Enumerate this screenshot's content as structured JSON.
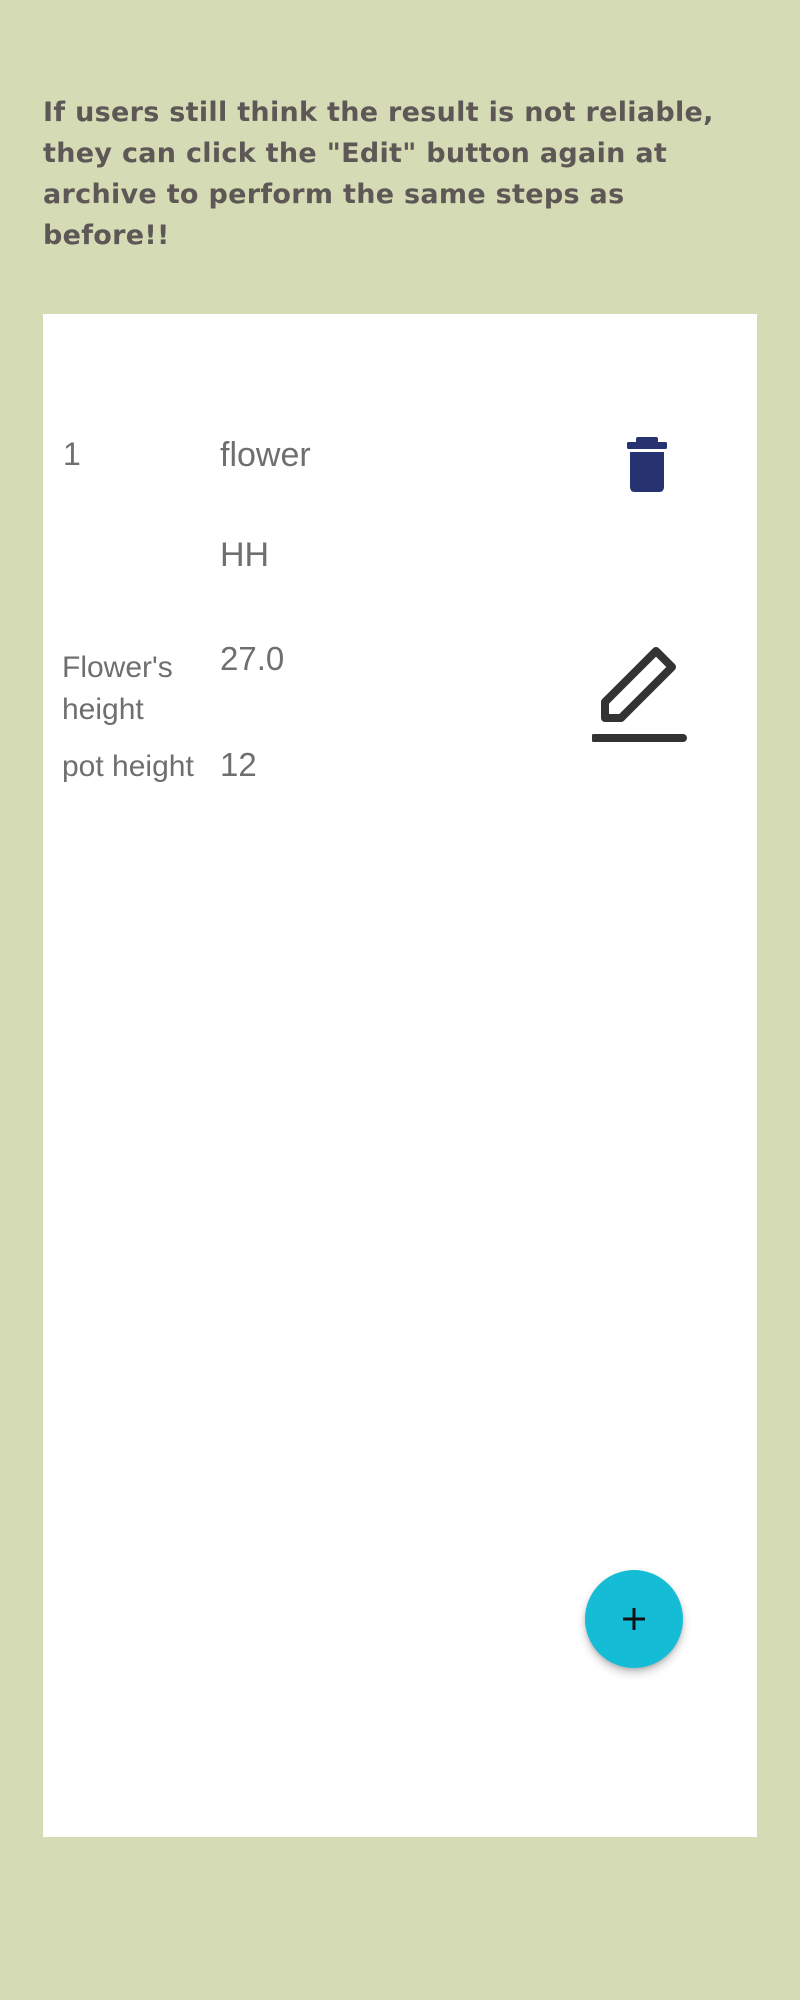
{
  "instruction": {
    "text": "If users still think the result is not reliable, they can click the \"Edit\" button again at archive  to perform the same steps as before!!"
  },
  "record": {
    "index": "1",
    "name": "flower",
    "code": "HH",
    "fields": [
      {
        "label": "Flower's height",
        "value": "27.0"
      },
      {
        "label": "pot height",
        "value": "12"
      }
    ]
  },
  "actions": {
    "delete_icon": "trash-icon",
    "edit_icon": "pencil-icon",
    "add_icon": "plus-icon"
  },
  "colors": {
    "background": "#d5dbb5",
    "panel": "#ffffff",
    "caption_text": "#5d5856",
    "trash_icon": "#273370",
    "pencil_icon": "#333333",
    "fab": "#15bcd6"
  }
}
